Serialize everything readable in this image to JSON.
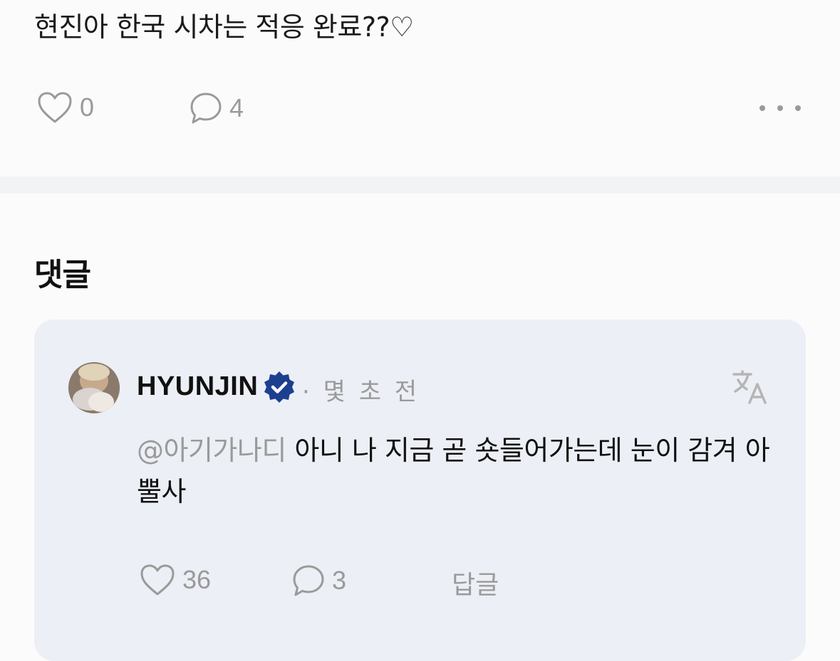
{
  "post": {
    "text": "현진아 한국 시차는 적응 완료??♡",
    "like_count": "0",
    "comment_count": "4"
  },
  "comments_section": {
    "title": "댓글"
  },
  "comment": {
    "author": "HYUNJIN",
    "time": "· 몇 초 전",
    "mention": "@아기가나디",
    "text": " 아니 나 지금 곧 숏들어가는데 눈이 감겨 아뿔사",
    "like_count": "36",
    "reply_count": "3",
    "reply_label": "답글"
  },
  "icons": {
    "like": "heart-icon",
    "comment": "speech-bubble-icon",
    "more": "more-horizontal-icon",
    "verified": "verified-badge-icon",
    "translate": "translate-icon"
  },
  "colors": {
    "background": "#fbfbfc",
    "card": "#eceff5",
    "muted": "#9a9a9a",
    "verified": "#1d3f8f"
  }
}
